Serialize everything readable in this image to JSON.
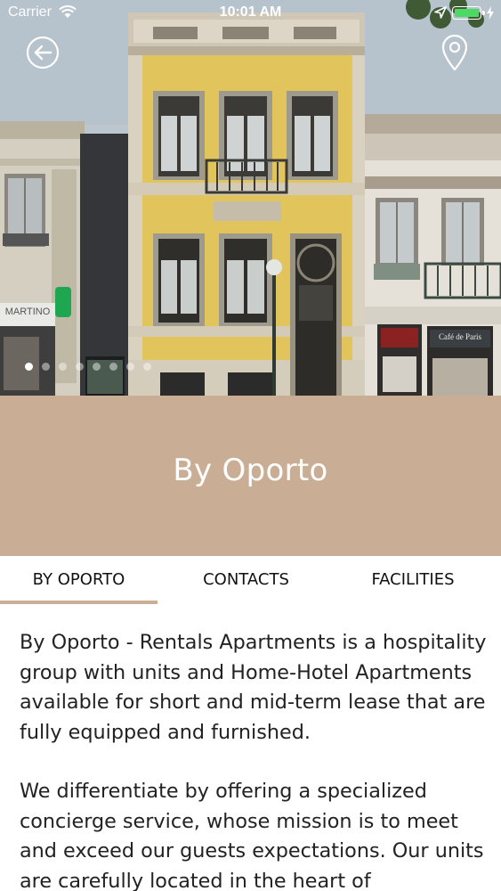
{
  "status_bar": {
    "carrier": "Carrier",
    "time": "10:01 AM",
    "battery_color": "#4cd964"
  },
  "hero": {
    "back_icon": "back-arrow-circle-icon",
    "map_icon": "map-pin-icon",
    "carousel_dots": 8,
    "active_dot": 0,
    "shop_signs": [
      "MARTINO",
      "Café de Paris"
    ]
  },
  "title": "By Oporto",
  "tabs": [
    {
      "label": "BY OPORTO",
      "active": true
    },
    {
      "label": "CONTACTS",
      "active": false
    },
    {
      "label": "FACILITIES",
      "active": false
    }
  ],
  "content": {
    "paragraphs": [
      "By Oporto - Rentals Apartments is a hospitality group with units and Home-Hotel Apartments available for short and mid-term lease that are fully equipped and furnished.",
      "We differentiate by offering a specialized concierge service, whose mission is to meet and exceed our guests expectations. Our units are carefully located in the heart of"
    ]
  },
  "colors": {
    "accent": "#c9ae95",
    "tab_underline": "#c9ae95"
  }
}
